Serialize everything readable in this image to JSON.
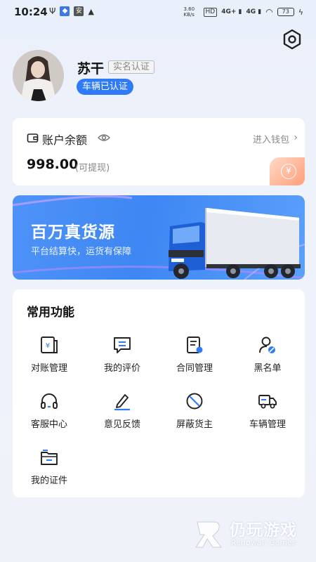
{
  "status_bar": {
    "time": "10:24",
    "net_speed": "3.60 KB/s",
    "hd_label": "HD",
    "signal1": "4G+",
    "signal2": "4G",
    "battery": "73"
  },
  "profile": {
    "name": "苏干",
    "verify_tag": "实名认证",
    "vehicle_badge": "车辆已认证"
  },
  "balance": {
    "title": "账户余额",
    "wallet_link": "进入钱包",
    "amount": "998.00",
    "note": "(可提现)",
    "coin_symbol": "¥"
  },
  "banner": {
    "title": "百万真货源",
    "subtitle": "平台结算快，运货有保障"
  },
  "functions": {
    "title": "常用功能",
    "items": [
      {
        "label": "对账管理",
        "icon": "ledger-icon"
      },
      {
        "label": "我的评价",
        "icon": "comment-icon"
      },
      {
        "label": "合同管理",
        "icon": "contract-icon"
      },
      {
        "label": "黑名单",
        "icon": "blacklist-icon"
      },
      {
        "label": "客服中心",
        "icon": "headset-icon"
      },
      {
        "label": "意见反馈",
        "icon": "pen-icon"
      },
      {
        "label": "屏蔽货主",
        "icon": "block-icon"
      },
      {
        "label": "车辆管理",
        "icon": "truck-icon"
      },
      {
        "label": "我的证件",
        "icon": "folder-icon"
      }
    ]
  },
  "watermark": {
    "cn": "仍玩游戏",
    "en": "Rengwan Games"
  },
  "colors": {
    "accent": "#2f7bf5",
    "banner": "#3e86f3",
    "coin": "#ff9f7a"
  }
}
